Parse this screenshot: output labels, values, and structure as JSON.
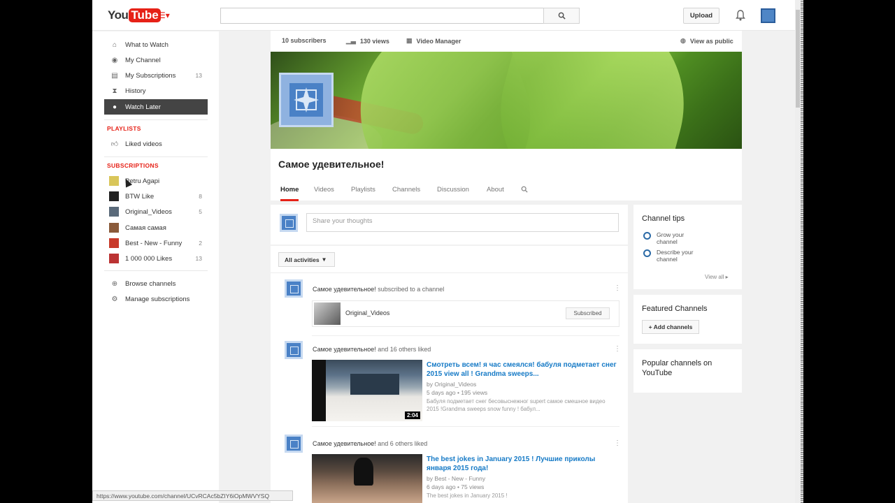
{
  "header": {
    "logo_you": "You",
    "logo_tube": "Tube",
    "search_placeholder": "",
    "upload_label": "Upload"
  },
  "sidebar": {
    "nav": [
      {
        "label": "What to Watch",
        "icon": "home-icon"
      },
      {
        "label": "My Channel",
        "icon": "user-icon"
      },
      {
        "label": "My Subscriptions",
        "icon": "subscriptions-icon",
        "count": "13"
      },
      {
        "label": "History",
        "icon": "hourglass-icon"
      },
      {
        "label": "Watch Later",
        "icon": "clock-icon",
        "active": true
      }
    ],
    "playlists_title": "PLAYLISTS",
    "playlists": [
      {
        "label": "Liked videos",
        "icon": "thumbs-up-icon"
      }
    ],
    "subscriptions_title": "SUBSCRIPTIONS",
    "subscriptions": [
      {
        "label": "Petru Agapi",
        "count": ""
      },
      {
        "label": "BTW Like",
        "count": "8"
      },
      {
        "label": "Original_Videos",
        "count": "5"
      },
      {
        "label": "Самая самая",
        "count": ""
      },
      {
        "label": "Best - New - Funny",
        "count": "2"
      },
      {
        "label": "1 000 000 Likes",
        "count": "13"
      }
    ],
    "bottom": [
      {
        "label": "Browse channels",
        "icon": "plus-circle-icon"
      },
      {
        "label": "Manage subscriptions",
        "icon": "gear-icon"
      }
    ]
  },
  "channel": {
    "subscribers": "10 subscribers",
    "views": "130 views",
    "video_manager": "Video Manager",
    "view_as_public": "View as public",
    "title": "Самое удевительное!",
    "tabs": [
      "Home",
      "Videos",
      "Playlists",
      "Channels",
      "Discussion",
      "About"
    ]
  },
  "feed": {
    "share_placeholder": "Share your thoughts",
    "filter_label": "All activities",
    "activities": [
      {
        "actor": "Самое удевительное!",
        "action": " subscribed to a channel",
        "channel_name": "Original_Videos",
        "subscribed_label": "Subscribed"
      },
      {
        "actor": "Самое удевительное!",
        "action": " and 16 others liked",
        "video_title": "Смотреть всем! я час смеялся! бабуля подметает снег 2015 view all ! Grandma sweeps...",
        "by": "by Original_Videos",
        "meta": "5 days ago  •  195 views",
        "desc": "Бабуля подметает снег бесовыснежног supert самое смешное видео 2015 !Grandma sweeps snow funny ! бабул...",
        "duration": "2:04"
      },
      {
        "actor": "Самое удевительное!",
        "action": " and 6 others liked",
        "video_title": "The best jokes in January 2015 ! Лучшие приколы января 2015 года!",
        "by": "by Best - New - Funny",
        "meta": "6 days ago  •  75 views",
        "desc": "The best jokes in January 2015 !"
      }
    ]
  },
  "right": {
    "tips_title": "Channel tips",
    "tips": [
      "Grow your channel",
      "Describe your channel"
    ],
    "view_all": "View all",
    "featured_title": "Featured Channels",
    "add_channels": "+ Add channels",
    "popular_title": "Popular channels on YouTube"
  },
  "status_url": "https://www.youtube.com/channel/UCvRCAc5bZIY6iOpMWVYSQ",
  "colors": {
    "brand_red": "#e62117",
    "link_blue": "#167ac6",
    "avatar_blue": "#4a81c6"
  }
}
